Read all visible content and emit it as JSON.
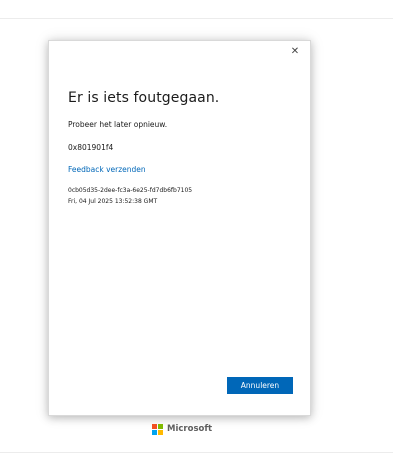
{
  "dialog": {
    "close_glyph": "✕",
    "title": "Er is iets foutgegaan.",
    "message": "Probeer het later opnieuw.",
    "error_code": "0x801901f4",
    "feedback_link": "Feedback verzenden",
    "correlation_id": "0cb05d35-2dee-fc3a-6e25-fd7db6fb7105",
    "timestamp": "Fri, 04 Jul 2025 13:52:38 GMT",
    "cancel_label": "Annuleren"
  },
  "footer": {
    "brand_name": "Microsoft",
    "logo_icon": "microsoft-logo-icon"
  },
  "colors": {
    "accent": "#0067b8",
    "link": "#0067b8",
    "logo_red": "#f25022",
    "logo_green": "#7fba00",
    "logo_blue": "#00a4ef",
    "logo_yellow": "#ffb900"
  }
}
